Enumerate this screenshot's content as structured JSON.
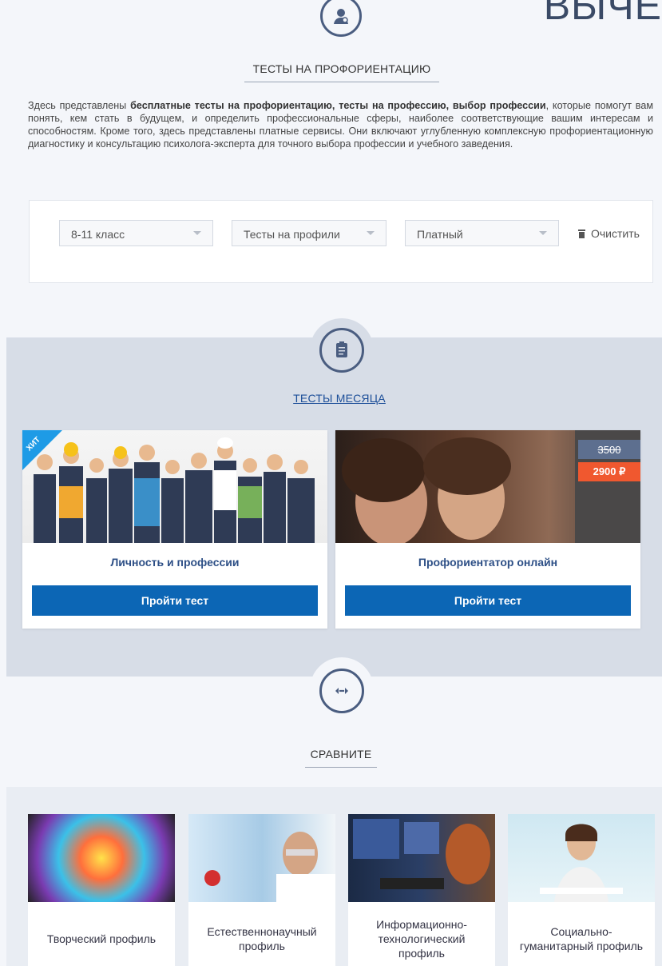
{
  "corner_partial_text": "ВЫЧЕ",
  "colors": {
    "accent": "#0c66b5",
    "title_blue": "#2d4f86",
    "hit_badge": "#1e9be6",
    "price_new": "#f0582f",
    "price_old": "#5d6f8f"
  },
  "profor": {
    "icon": "person-gear-icon",
    "title": "ТЕСТЫ НА ПРОФОРИЕНТАЦИЮ",
    "intro_start": "Здесь представлены ",
    "intro_bold": "бесплатные тесты на профориентацию, тесты на профессию, выбор профессии",
    "intro_rest": ", которые помогут вам понять, кем стать в будущем, и определить профессиональные сферы, наиболее соответствующие вашим интересам и способностям. Кроме того, здесь представлены платные сервисы. Они включают углубленную комплексную профориентационную диагностику и консультацию психолога-эксперта для точного выбора профессии и учебного заведения."
  },
  "filters": {
    "grade": "8-11 класс",
    "type": "Тесты на профили",
    "price": "Платный",
    "clear": "Очистить"
  },
  "month": {
    "icon": "document-icon",
    "title": "ТЕСТЫ МЕСЯЦА",
    "cards": [
      {
        "name": "Личность и профессии",
        "badge": "ХИТ",
        "button": "Пройти тест"
      },
      {
        "name": "Профориентатор онлайн",
        "price_old": "3500",
        "price_new": "2900 ₽",
        "button": "Пройти тест"
      }
    ]
  },
  "compare": {
    "icon": "compare-arrows-icon",
    "title": "СРАВНИТЕ"
  },
  "profiles": [
    {
      "name": "Творческий профиль"
    },
    {
      "name": "Естественнонаучный профиль"
    },
    {
      "name": "Информационно-технологический профиль"
    },
    {
      "name": "Социально-гуманитарный профиль"
    }
  ]
}
